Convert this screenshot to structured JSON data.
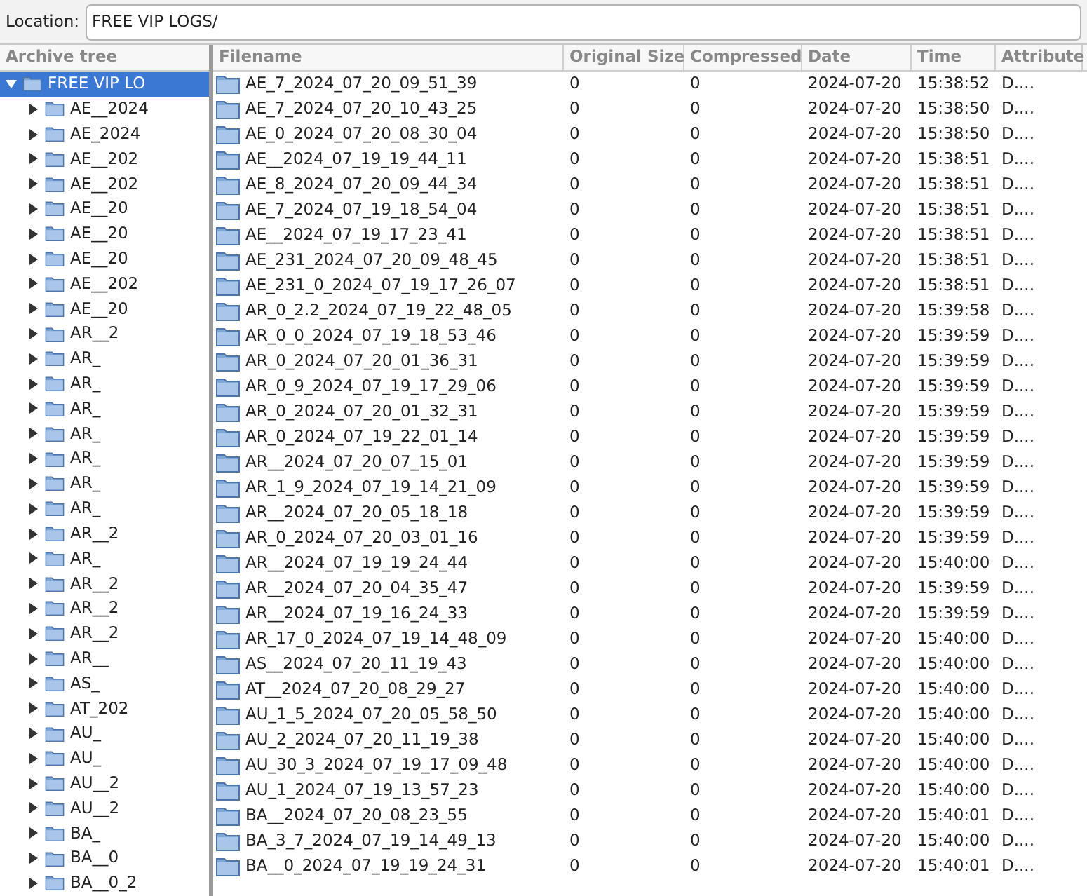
{
  "location": {
    "label": "Location:",
    "value": "FREE VIP LOGS/"
  },
  "tree": {
    "title": "Archive tree",
    "root": {
      "label": "FREE VIP LO",
      "expanded": true,
      "selected": true,
      "children": [
        {
          "label": "AE__2024",
          "expanded": false
        },
        {
          "label": "AE_2024",
          "expanded": false
        },
        {
          "label": "AE__202",
          "expanded": false
        },
        {
          "label": "AE__202",
          "expanded": false
        },
        {
          "label": "AE__20",
          "expanded": false
        },
        {
          "label": "AE__20",
          "expanded": false
        },
        {
          "label": "AE__20",
          "expanded": false
        },
        {
          "label": "AE__202",
          "expanded": false
        },
        {
          "label": "AE__20",
          "expanded": false
        },
        {
          "label": "AR__2",
          "expanded": false
        },
        {
          "label": "AR_",
          "expanded": false
        },
        {
          "label": "AR_",
          "expanded": false
        },
        {
          "label": "AR_",
          "expanded": false
        },
        {
          "label": "AR_",
          "expanded": false
        },
        {
          "label": "AR_",
          "expanded": false
        },
        {
          "label": "AR_",
          "expanded": false
        },
        {
          "label": "AR_",
          "expanded": false
        },
        {
          "label": "AR__2",
          "expanded": false
        },
        {
          "label": "AR_",
          "expanded": false
        },
        {
          "label": "AR__2",
          "expanded": false
        },
        {
          "label": "AR__2",
          "expanded": false
        },
        {
          "label": "AR__2",
          "expanded": false
        },
        {
          "label": "AR__",
          "expanded": false
        },
        {
          "label": "AS_",
          "expanded": false
        },
        {
          "label": "AT_202",
          "expanded": false
        },
        {
          "label": "AU_",
          "expanded": false
        },
        {
          "label": "AU_",
          "expanded": false
        },
        {
          "label": "AU__2",
          "expanded": false
        },
        {
          "label": "AU__2",
          "expanded": false
        },
        {
          "label": "BA_",
          "expanded": false
        },
        {
          "label": "BA__0",
          "expanded": false
        },
        {
          "label": "BA__0_2",
          "expanded": false
        }
      ]
    }
  },
  "table": {
    "columns": [
      "Filename",
      "Original Size",
      "Compressed",
      "Date",
      "Time",
      "Attribute"
    ],
    "rows": [
      {
        "name": "AE_7_2024_07_20_09_51_39",
        "original_size": "0",
        "compressed": "0",
        "date": "2024-07-20",
        "time": "15:38:52",
        "attribute": "D...."
      },
      {
        "name": "AE_7_2024_07_20_10_43_25",
        "original_size": "0",
        "compressed": "0",
        "date": "2024-07-20",
        "time": "15:38:50",
        "attribute": "D...."
      },
      {
        "name": "AE_0_2024_07_20_08_30_04",
        "original_size": "0",
        "compressed": "0",
        "date": "2024-07-20",
        "time": "15:38:50",
        "attribute": "D...."
      },
      {
        "name": "AE__2024_07_19_19_44_11",
        "original_size": "0",
        "compressed": "0",
        "date": "2024-07-20",
        "time": "15:38:51",
        "attribute": "D...."
      },
      {
        "name": "AE_8_2024_07_20_09_44_34",
        "original_size": "0",
        "compressed": "0",
        "date": "2024-07-20",
        "time": "15:38:51",
        "attribute": "D...."
      },
      {
        "name": "AE_7_2024_07_19_18_54_04",
        "original_size": "0",
        "compressed": "0",
        "date": "2024-07-20",
        "time": "15:38:51",
        "attribute": "D...."
      },
      {
        "name": "AE__2024_07_19_17_23_41",
        "original_size": "0",
        "compressed": "0",
        "date": "2024-07-20",
        "time": "15:38:51",
        "attribute": "D...."
      },
      {
        "name": "AE_231_2024_07_20_09_48_45",
        "original_size": "0",
        "compressed": "0",
        "date": "2024-07-20",
        "time": "15:38:51",
        "attribute": "D...."
      },
      {
        "name": "AE_231_0_2024_07_19_17_26_07",
        "original_size": "0",
        "compressed": "0",
        "date": "2024-07-20",
        "time": "15:38:51",
        "attribute": "D...."
      },
      {
        "name": "AR_0_2.2_2024_07_19_22_48_05",
        "original_size": "0",
        "compressed": "0",
        "date": "2024-07-20",
        "time": "15:39:58",
        "attribute": "D...."
      },
      {
        "name": "AR_0_0_2024_07_19_18_53_46",
        "original_size": "0",
        "compressed": "0",
        "date": "2024-07-20",
        "time": "15:39:59",
        "attribute": "D...."
      },
      {
        "name": "AR_0_2024_07_20_01_36_31",
        "original_size": "0",
        "compressed": "0",
        "date": "2024-07-20",
        "time": "15:39:59",
        "attribute": "D...."
      },
      {
        "name": "AR_0_9_2024_07_19_17_29_06",
        "original_size": "0",
        "compressed": "0",
        "date": "2024-07-20",
        "time": "15:39:59",
        "attribute": "D...."
      },
      {
        "name": "AR_0_2024_07_20_01_32_31",
        "original_size": "0",
        "compressed": "0",
        "date": "2024-07-20",
        "time": "15:39:59",
        "attribute": "D...."
      },
      {
        "name": "AR_0_2024_07_19_22_01_14",
        "original_size": "0",
        "compressed": "0",
        "date": "2024-07-20",
        "time": "15:39:59",
        "attribute": "D...."
      },
      {
        "name": "AR__2024_07_20_07_15_01",
        "original_size": "0",
        "compressed": "0",
        "date": "2024-07-20",
        "time": "15:39:59",
        "attribute": "D...."
      },
      {
        "name": "AR_1_9_2024_07_19_14_21_09",
        "original_size": "0",
        "compressed": "0",
        "date": "2024-07-20",
        "time": "15:39:59",
        "attribute": "D...."
      },
      {
        "name": "AR__2024_07_20_05_18_18",
        "original_size": "0",
        "compressed": "0",
        "date": "2024-07-20",
        "time": "15:39:59",
        "attribute": "D...."
      },
      {
        "name": "AR_0_2024_07_20_03_01_16",
        "original_size": "0",
        "compressed": "0",
        "date": "2024-07-20",
        "time": "15:39:59",
        "attribute": "D...."
      },
      {
        "name": "AR__2024_07_19_19_24_44",
        "original_size": "0",
        "compressed": "0",
        "date": "2024-07-20",
        "time": "15:40:00",
        "attribute": "D...."
      },
      {
        "name": "AR__2024_07_20_04_35_47",
        "original_size": "0",
        "compressed": "0",
        "date": "2024-07-20",
        "time": "15:39:59",
        "attribute": "D...."
      },
      {
        "name": "AR__2024_07_19_16_24_33",
        "original_size": "0",
        "compressed": "0",
        "date": "2024-07-20",
        "time": "15:39:59",
        "attribute": "D...."
      },
      {
        "name": "AR_17_0_2024_07_19_14_48_09",
        "original_size": "0",
        "compressed": "0",
        "date": "2024-07-20",
        "time": "15:40:00",
        "attribute": "D...."
      },
      {
        "name": "AS__2024_07_20_11_19_43",
        "original_size": "0",
        "compressed": "0",
        "date": "2024-07-20",
        "time": "15:40:00",
        "attribute": "D...."
      },
      {
        "name": "AT__2024_07_20_08_29_27",
        "original_size": "0",
        "compressed": "0",
        "date": "2024-07-20",
        "time": "15:40:00",
        "attribute": "D...."
      },
      {
        "name": "AU_1_5_2024_07_20_05_58_50",
        "original_size": "0",
        "compressed": "0",
        "date": "2024-07-20",
        "time": "15:40:00",
        "attribute": "D...."
      },
      {
        "name": "AU_2_2024_07_20_11_19_38",
        "original_size": "0",
        "compressed": "0",
        "date": "2024-07-20",
        "time": "15:40:00",
        "attribute": "D...."
      },
      {
        "name": "AU_30_3_2024_07_19_17_09_48",
        "original_size": "0",
        "compressed": "0",
        "date": "2024-07-20",
        "time": "15:40:00",
        "attribute": "D...."
      },
      {
        "name": "AU_1_2024_07_19_13_57_23",
        "original_size": "0",
        "compressed": "0",
        "date": "2024-07-20",
        "time": "15:40:00",
        "attribute": "D...."
      },
      {
        "name": "BA__2024_07_20_08_23_55",
        "original_size": "0",
        "compressed": "0",
        "date": "2024-07-20",
        "time": "15:40:01",
        "attribute": "D...."
      },
      {
        "name": "BA_3_7_2024_07_19_14_49_13",
        "original_size": "0",
        "compressed": "0",
        "date": "2024-07-20",
        "time": "15:40:00",
        "attribute": "D...."
      },
      {
        "name": "BA__0_2024_07_19_19_24_31",
        "original_size": "0",
        "compressed": "0",
        "date": "2024-07-20",
        "time": "15:40:01",
        "attribute": "D...."
      }
    ]
  }
}
